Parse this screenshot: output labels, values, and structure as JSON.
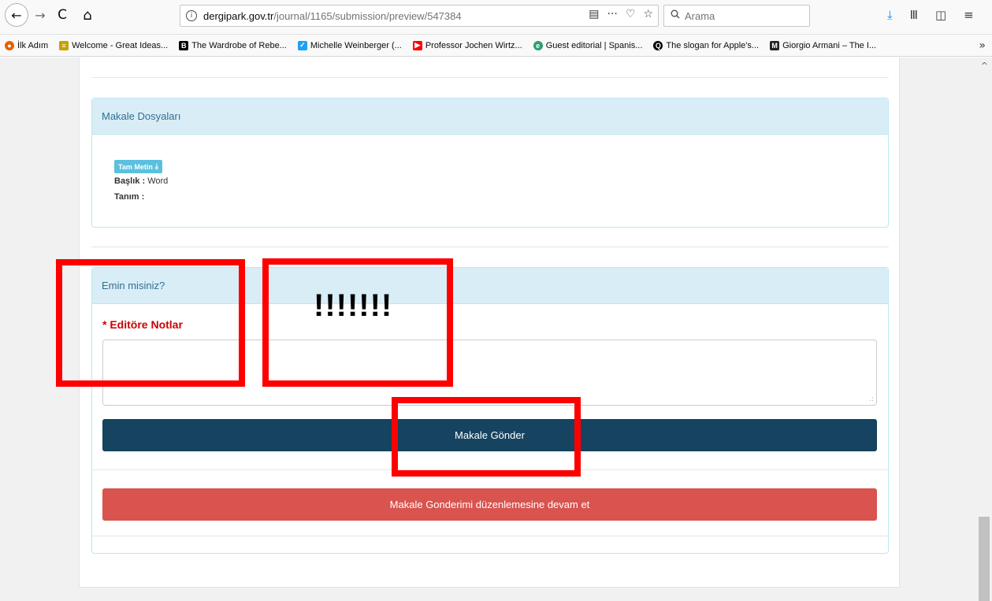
{
  "browser": {
    "url_host": "dergipark.gov.tr",
    "url_path": "/journal/1165/submission/preview/547384",
    "search_placeholder": "Arama",
    "icons": {
      "back": "←",
      "forward": "→",
      "reload": "C",
      "home": "⌂",
      "info": "i",
      "reader": "▤",
      "more": "···",
      "pocket": "♡",
      "star": "☆",
      "search": "🔍",
      "download": "⤓",
      "library": "Ⅲ",
      "sidebar": "◫",
      "menu": "≡",
      "overflow": "»",
      "scroll_up": "^"
    }
  },
  "bookmarks": [
    {
      "label": "İlk Adım",
      "icon": "firefox-icon",
      "glyph": "●",
      "color": "#e66000"
    },
    {
      "label": "Welcome - Great Ideas...",
      "icon": "site-icon",
      "glyph": "≡",
      "color": "#c8a000"
    },
    {
      "label": "The Wardrobe of Rebe...",
      "icon": "bbc-icon",
      "glyph": "B",
      "color": "#000000"
    },
    {
      "label": "Michelle Weinberger (...",
      "icon": "twitter-icon",
      "glyph": "✓",
      "color": "#1da1f2"
    },
    {
      "label": "Professor Jochen Wirtz...",
      "icon": "youtube-icon",
      "glyph": "▶",
      "color": "#ff0000"
    },
    {
      "label": "Guest editorial | Spanis...",
      "icon": "elsevier-icon",
      "glyph": "e",
      "color": "#2e9e6e"
    },
    {
      "label": "The slogan for Apple's...",
      "icon": "quora-icon",
      "glyph": "Q",
      "color": "#000000"
    },
    {
      "label": "Giorgio Armani – The I...",
      "icon": "medium-icon",
      "glyph": "M",
      "color": "#222222"
    }
  ],
  "files_panel": {
    "title": "Makale Dosyaları",
    "badge": "Tam Metin",
    "badge_icon": "⤓",
    "title_label": "Başlık :",
    "title_value": "Word",
    "desc_label": "Tanım :"
  },
  "confirm_panel": {
    "title": "Emin misiniz?",
    "notes_label": "* Editöre Notlar",
    "notes_value": "",
    "resize_glyph": ".:",
    "submit_button": "Makale Gönder",
    "continue_button": "Makale Gonderimi düzenlemesine devam et"
  },
  "annotation": {
    "exclamation": "!!!!!!!",
    "color": "#ff0000"
  }
}
